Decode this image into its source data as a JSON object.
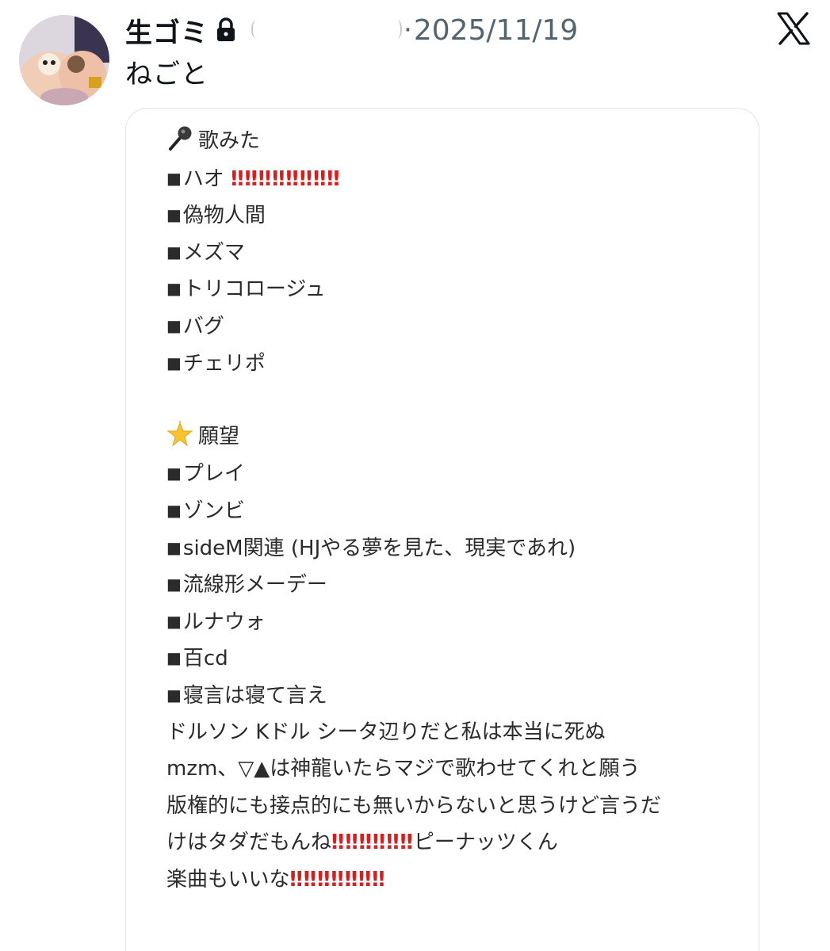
{
  "author": {
    "display_name": "生ゴミ",
    "separator": "·",
    "date": "2025/11/19"
  },
  "tweet_text": "ねごと",
  "icons": {
    "lock": "lock-icon",
    "x_logo": "x-logo-icon",
    "mic": "microphone-icon",
    "star": "glowing-star-icon"
  },
  "memo": {
    "section1_title": "歌みた",
    "section1_items": [
      "ハオ",
      "偽物人間",
      "メズマ",
      "トリコロージュ",
      "バグ",
      "チェリポ"
    ],
    "bangs_row1": "‼︎‼︎‼︎‼︎‼︎‼︎‼︎‼︎",
    "section2_title": "願望",
    "section2_items": [
      "プレイ",
      "ゾンビ",
      "sideM関連 (HJやる夢を見た、現実であれ)",
      "流線形メーデー",
      "ルナウォ",
      "百cd",
      "寝言は寝て言え"
    ],
    "bullet": "■",
    "line1": "ドルソン Kドル シータ辺りだと私は本当に死ぬ",
    "line2": "mzm、▽▲は神龍いたらマジで歌わせてくれと願う",
    "line3": "版権的にも接点的にも無いからないと思うけど言うだ",
    "line4a": "けはタダだもんね",
    "line4_bangs": "‼︎‼︎‼︎‼︎‼︎‼︎",
    "line4b": "ピーナッツくん",
    "line5a": "楽曲もいいな",
    "line5_bangs": "‼︎‼︎‼︎‼︎‼︎‼︎‼︎"
  },
  "colors": {
    "text": "#0f1419",
    "secondary": "#536471",
    "bang_red": "#d81e1e"
  }
}
